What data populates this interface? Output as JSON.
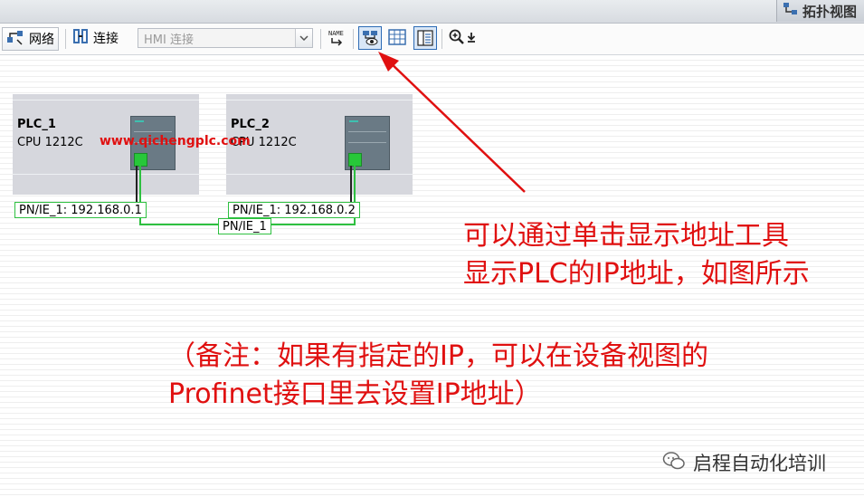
{
  "header": {
    "view_tab_label": "拓扑视图"
  },
  "toolbar": {
    "network_label": "网络",
    "connections_label": "连接",
    "connection_type_value": "HMI 连接",
    "name_icon_text": "NAME"
  },
  "devices": [
    {
      "name": "PLC_1",
      "cpu": "CPU 1212C",
      "interface_label": "PN/IE_1:  192.168.0.1"
    },
    {
      "name": "PLC_2",
      "cpu": "CPU 1212C",
      "interface_label": "PN/IE_1:  192.168.0.2"
    }
  ],
  "network_label": "PN/IE_1",
  "watermark": "www.qichengplc.com",
  "annotation": {
    "line1": "可以通过单击显示地址工具",
    "line2": "显示PLC的IP地址，如图所示",
    "line3": "（备注：如果有指定的IP，可以在设备视图的",
    "line4": "Profinet接口里去设置IP地址）"
  },
  "footer_brand": "启程自动化培训",
  "colors": {
    "annotation": "#e01010",
    "network": "#2ec040",
    "selection": "#2d6bb5"
  }
}
